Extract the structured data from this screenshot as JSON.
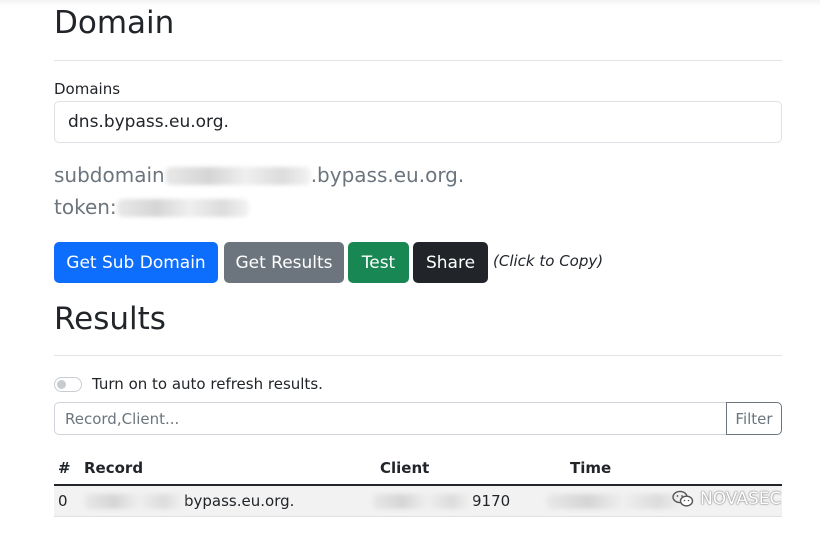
{
  "domain_section": {
    "heading": "Domain",
    "domains_label": "Domains",
    "domains_value": "dns.bypass.eu.org.",
    "subdomain_prefix": "subdomain",
    "subdomain_suffix": ".bypass.eu.org.",
    "token_prefix": "token:"
  },
  "actions": {
    "get_sub_domain": "Get Sub Domain",
    "get_results": "Get Results",
    "test": "Test",
    "share": "Share",
    "click_to_copy": "(Click to Copy)"
  },
  "results_section": {
    "heading": "Results",
    "auto_refresh_label": "Turn on to auto refresh results.",
    "filter_placeholder": "Record,Client...",
    "filter_button": "Filter",
    "columns": [
      "#",
      "Record",
      "Client",
      "Time"
    ],
    "rows": [
      {
        "index": "0",
        "record_suffix": "bypass.eu.org.",
        "client_suffix": "9170"
      }
    ]
  },
  "watermark": {
    "text": "NOVASEC",
    "icon": "wechat-icon"
  },
  "colors": {
    "primary": "#0d6efd",
    "secondary": "#6c757d",
    "success": "#198754",
    "dark": "#212529"
  }
}
